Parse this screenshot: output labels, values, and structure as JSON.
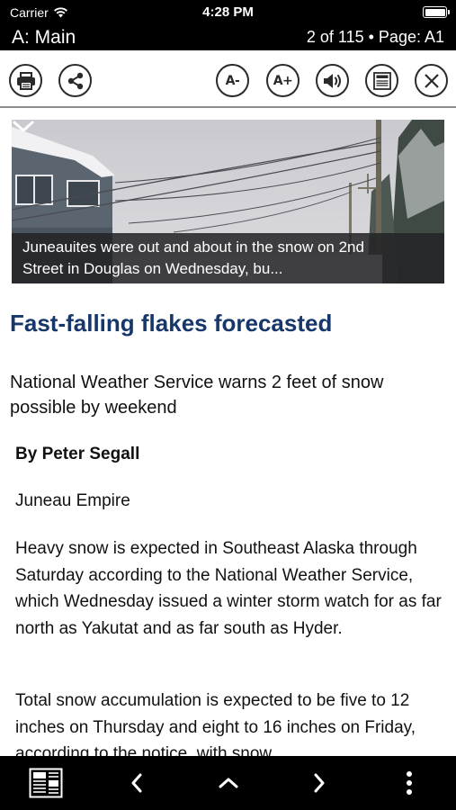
{
  "status_bar": {
    "carrier": "Carrier",
    "time": "4:28 PM"
  },
  "title_bar": {
    "section": "A: Main",
    "page_info": "2 of 115 • Page: A1"
  },
  "toolbar": {
    "print_icon": "printer-icon",
    "share_icon": "share-icon",
    "decrease_font_label": "A-",
    "increase_font_label": "A+",
    "audio_icon": "speaker-icon",
    "page_view_icon": "newspaper-icon",
    "close_icon": "close-icon"
  },
  "article": {
    "photo_caption": "Juneauites were out and about in the snow on 2nd Street in Douglas on Wednesday, bu...",
    "headline": "Fast-falling flakes forecasted",
    "subheadline": "National Weather Service warns 2 feet of snow possible by weekend",
    "byline": "By Peter Segall",
    "source": "Juneau Empire",
    "paragraphs": [
      "Heavy snow is expected in Southeast Alaska through Saturday according to the National Weather Service, which Wednesday issued a winter storm watch for as far north as Yakutat and as far south as Hyder.",
      "Total snow accumulation is expected to be five to 12 inches on Thursday and eight to 16 inches on Friday, according to the notice, with snow"
    ]
  },
  "bottom_bar": {
    "pages_icon": "page-thumbnails-icon",
    "prev_icon": "chevron-left-icon",
    "up_icon": "chevron-up-icon",
    "next_icon": "chevron-right-icon",
    "more_icon": "more-vertical-icon"
  },
  "colors": {
    "headline": "#17376b",
    "bars": "#000000",
    "content_background": "#ffffff"
  }
}
